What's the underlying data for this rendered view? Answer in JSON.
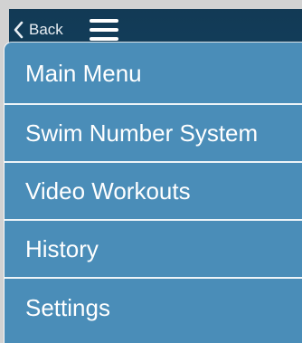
{
  "navbar": {
    "back_label": "Back",
    "back_icon": "chevron-left-icon",
    "menu_icon": "hamburger-menu-icon"
  },
  "menu": {
    "items": [
      {
        "label": "Main Menu"
      },
      {
        "label": "Swim Number System"
      },
      {
        "label": "Video Workouts"
      },
      {
        "label": "History"
      },
      {
        "label": "Settings"
      }
    ]
  },
  "colors": {
    "background": "#15456a",
    "menu_background": "#4a8db8",
    "divider": "#ffffff",
    "text": "#ffffff"
  }
}
